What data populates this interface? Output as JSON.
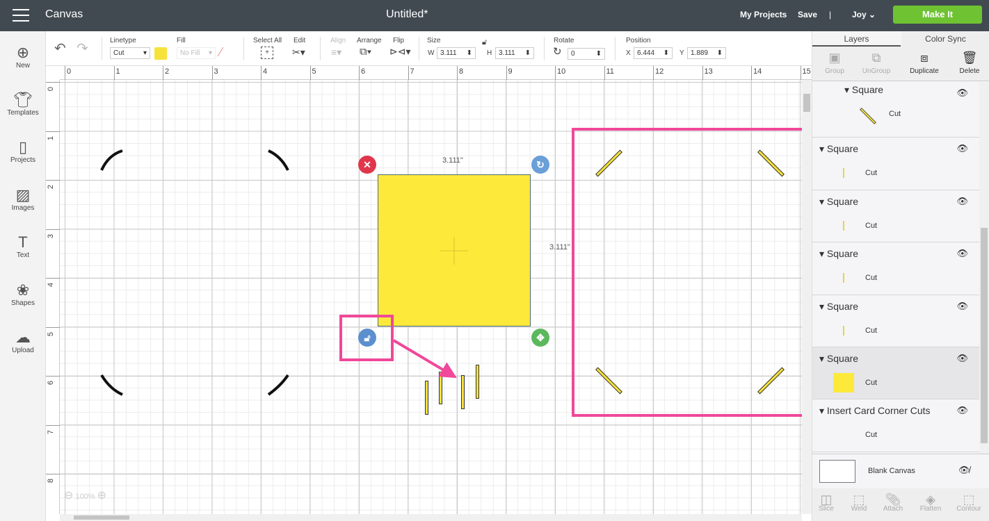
{
  "topbar": {
    "app_name": "Canvas",
    "doc_title": "Untitled*",
    "my_projects": "My Projects",
    "save": "Save",
    "divider": "|",
    "user": "Joy",
    "make_it": "Make It"
  },
  "sidebar": {
    "items": [
      {
        "label": "New",
        "icon": "plus-circle-icon"
      },
      {
        "label": "Templates",
        "icon": "tshirt-icon"
      },
      {
        "label": "Projects",
        "icon": "notebook-icon"
      },
      {
        "label": "Images",
        "icon": "image-icon"
      },
      {
        "label": "Text",
        "icon": "text-icon"
      },
      {
        "label": "Shapes",
        "icon": "shapes-icon"
      },
      {
        "label": "Upload",
        "icon": "cloud-upload-icon"
      }
    ]
  },
  "toolbar": {
    "linetype_label": "Linetype",
    "linetype_value": "Cut",
    "fill_label": "Fill",
    "fill_value": "No Fill",
    "select_all": "Select All",
    "edit": "Edit",
    "align": "Align",
    "arrange": "Arrange",
    "flip": "Flip",
    "size_label": "Size",
    "w_label": "W",
    "w_value": "3.111",
    "h_label": "H",
    "h_value": "3.111",
    "rotate_label": "Rotate",
    "rotate_value": "0",
    "position_label": "Position",
    "x_label": "X",
    "x_value": "6.444",
    "y_label": "Y",
    "y_value": "1.889",
    "swatch_color": "#f7e23a"
  },
  "rulers": {
    "h": [
      "0",
      "1",
      "2",
      "3",
      "4",
      "5",
      "6",
      "7",
      "8",
      "9",
      "10",
      "11",
      "12",
      "13",
      "14",
      "15"
    ],
    "v": [
      "0",
      "1",
      "2",
      "3",
      "4",
      "5",
      "6",
      "7",
      "8"
    ]
  },
  "canvas": {
    "width_dim": "3.111\"",
    "height_dim": "3.111\"",
    "zoom": "100%",
    "shape_color": "#fde93a"
  },
  "panel": {
    "tabs": [
      "Layers",
      "Color Sync"
    ],
    "actions": [
      "Group",
      "UnGroup",
      "Duplicate",
      "Delete"
    ],
    "layers": [
      {
        "name": "Square",
        "op": "Cut"
      },
      {
        "name": "Square",
        "op": "Cut"
      },
      {
        "name": "Square",
        "op": "Cut"
      },
      {
        "name": "Square",
        "op": "Cut"
      },
      {
        "name": "Square",
        "op": "Cut"
      },
      {
        "name": "Square",
        "op": "Cut"
      },
      {
        "name": "Insert Card Corner Cuts",
        "op": "Cut"
      }
    ],
    "blank_canvas": "Blank Canvas",
    "bottom_actions": [
      "Slice",
      "Weld",
      "Attach",
      "Flatten",
      "Contour"
    ]
  },
  "annotation_color": "#f0489a"
}
